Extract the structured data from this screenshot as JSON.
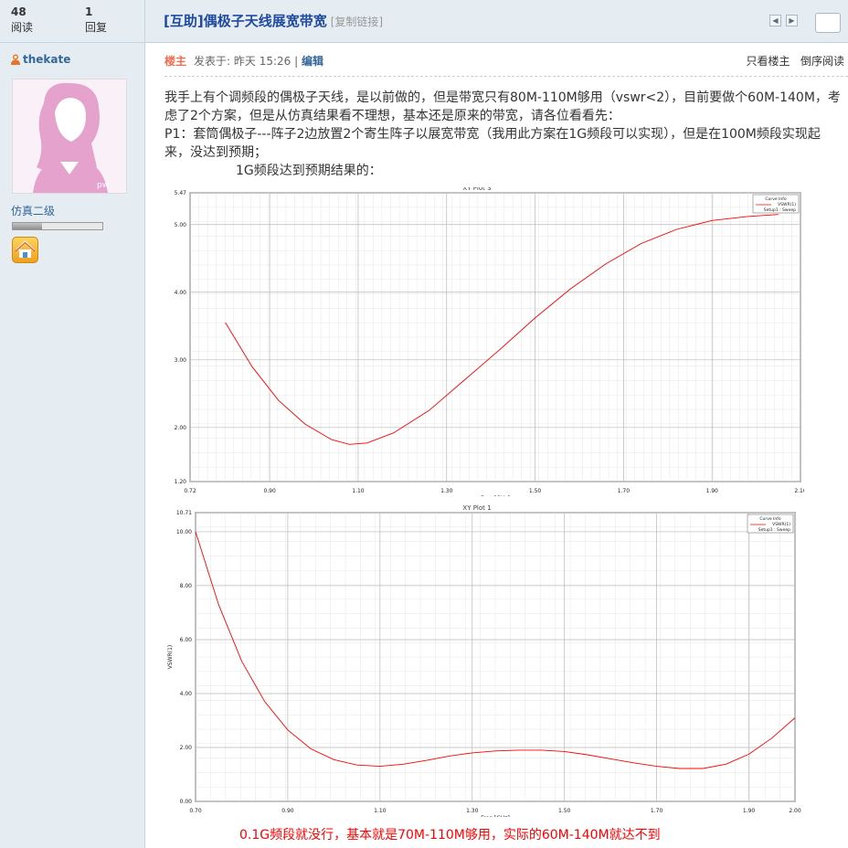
{
  "stats": {
    "views_count": "48",
    "views_label": "阅读",
    "replies_count": "1",
    "replies_label": "回复"
  },
  "thread": {
    "title": "[互助]偶极子天线展宽带宽",
    "copy_link": "[复制链接]"
  },
  "author": {
    "name": "thekate",
    "rank": "仿真二级",
    "rank_progress": 0.33
  },
  "post": {
    "role": "楼主",
    "meta": "发表于: 昨天 15:26 |",
    "edit": "编辑",
    "only_author": "只看楼主",
    "reverse": "倒序阅读",
    "paragraphs": [
      "我手上有个调频段的偶极子天线，是以前做的，但是带宽只有80M-110M够用（vswr<2），目前要做个60M-140M，考虑了2个方案，但是从仿真结果看不理想，基本还是原来的带宽，请各位看看先：",
      "P1：套筒偶极子---阵子2边放置2个寄生阵子以展宽带宽（我用此方案在1G频段可以实现），但是在100M频段实现起来，没达到预期；",
      "1G频段达到预期结果的："
    ],
    "caption": "0.1G频段就没行，基本就是70M-110M够用，实际的60M-140M就达不到"
  },
  "icons": {
    "user": "user-icon",
    "home": "home-icon",
    "prev": "arrow-left-icon",
    "next": "arrow-right-icon"
  },
  "colors": {
    "accent": "#336699",
    "curve": "#ff0000",
    "caption": "#ff0000",
    "role": "#f26c4f"
  },
  "chart_data": [
    {
      "type": "line",
      "title": "XY Plot 3",
      "xlabel": "Freq [GHz]",
      "ylabel": "",
      "xlim": [
        0.72,
        2.1
      ],
      "ylim": [
        1.2,
        5.47
      ],
      "xticks": [
        0.72,
        0.9,
        1.1,
        1.3,
        1.5,
        1.7,
        1.9,
        2.1
      ],
      "xtick_labels": [
        "0.72",
        "0.90",
        "1.10",
        "1.30",
        "1.50",
        "1.70",
        "1.90",
        "2.10"
      ],
      "yticks": [
        1.2,
        2.0,
        3.0,
        4.0,
        5.0,
        5.47
      ],
      "ytick_labels": [
        "1.20",
        "2.00",
        "3.00",
        "4.00",
        "5.00",
        "5.47"
      ],
      "legend_title": "Curve Info",
      "legend": "top-right",
      "series": [
        {
          "name": "VSWR(1)",
          "sub": "Setup1 : Sweep",
          "x": [
            0.8,
            0.86,
            0.92,
            0.98,
            1.04,
            1.08,
            1.12,
            1.18,
            1.26,
            1.34,
            1.42,
            1.5,
            1.58,
            1.66,
            1.74,
            1.82,
            1.9,
            1.98,
            2.05
          ],
          "y": [
            3.55,
            2.9,
            2.4,
            2.05,
            1.82,
            1.75,
            1.77,
            1.92,
            2.25,
            2.7,
            3.15,
            3.62,
            4.05,
            4.42,
            4.72,
            4.93,
            5.06,
            5.12,
            5.15
          ]
        }
      ]
    },
    {
      "type": "line",
      "title": "XY Plot 1",
      "xlabel": "Freq [GHz]",
      "ylabel": "VSWR(1)",
      "xlim": [
        0.7,
        2.0
      ],
      "ylim": [
        0.0,
        10.71
      ],
      "xticks": [
        0.7,
        0.9,
        1.1,
        1.3,
        1.5,
        1.7,
        1.9,
        2.0
      ],
      "xtick_labels": [
        "0.70",
        "0.90",
        "1.10",
        "1.30",
        "1.50",
        "1.70",
        "1.90",
        "2.00"
      ],
      "yticks": [
        0.0,
        2.0,
        4.0,
        6.0,
        8.0,
        10.0,
        10.71
      ],
      "ytick_labels": [
        "0.00",
        "2.00",
        "4.00",
        "6.00",
        "8.00",
        "10.00",
        "10.71"
      ],
      "legend_title": "Curve Info",
      "legend": "top-right",
      "series": [
        {
          "name": "VSWR(1)",
          "sub": "Setup1 : Sweep",
          "x": [
            0.7,
            0.75,
            0.8,
            0.85,
            0.9,
            0.95,
            1.0,
            1.05,
            1.1,
            1.15,
            1.2,
            1.25,
            1.3,
            1.35,
            1.4,
            1.45,
            1.5,
            1.55,
            1.6,
            1.65,
            1.7,
            1.75,
            1.8,
            1.85,
            1.9,
            1.95,
            2.0
          ],
          "y": [
            10.0,
            7.3,
            5.2,
            3.7,
            2.65,
            1.95,
            1.55,
            1.35,
            1.3,
            1.38,
            1.52,
            1.68,
            1.8,
            1.87,
            1.9,
            1.9,
            1.85,
            1.73,
            1.58,
            1.43,
            1.3,
            1.22,
            1.22,
            1.38,
            1.75,
            2.35,
            3.1
          ]
        }
      ]
    }
  ]
}
